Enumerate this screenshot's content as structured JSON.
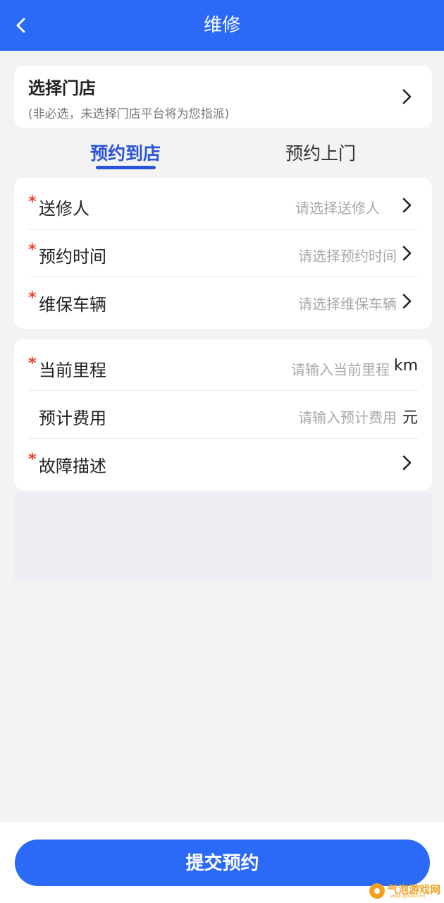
{
  "header": {
    "title": "维修"
  },
  "store": {
    "title": "选择门店",
    "subtitle": "(非必选，未选择门店平台将为您指派)"
  },
  "tabs": [
    {
      "label": "预约到店",
      "active": true
    },
    {
      "label": "预约上门",
      "active": false
    }
  ],
  "form1": {
    "rows": [
      {
        "required": true,
        "label": "送修人",
        "placeholder": "请选择送修人"
      },
      {
        "required": true,
        "label": "预约时间",
        "placeholder": "请选择预约时间"
      },
      {
        "required": true,
        "label": "维保车辆",
        "placeholder": "请选择维保车辆"
      }
    ]
  },
  "form2": {
    "rows": [
      {
        "required": true,
        "label": "当前里程",
        "placeholder": "请输入当前里程",
        "unit": "km"
      },
      {
        "required": false,
        "label": "预计费用",
        "placeholder": "请输入预计费用",
        "unit": "元"
      },
      {
        "required": true,
        "label": "故障描述"
      }
    ]
  },
  "required_mark": "*",
  "submit": {
    "label": "提交预约"
  },
  "watermark": {
    "text": "气泡游戏网",
    "sub": "www.qpxzw.com"
  },
  "colors": {
    "primary": "#2a6af6",
    "tab_active": "#2a55d8",
    "required": "#e8402e",
    "watermark": "#f2a11e"
  }
}
